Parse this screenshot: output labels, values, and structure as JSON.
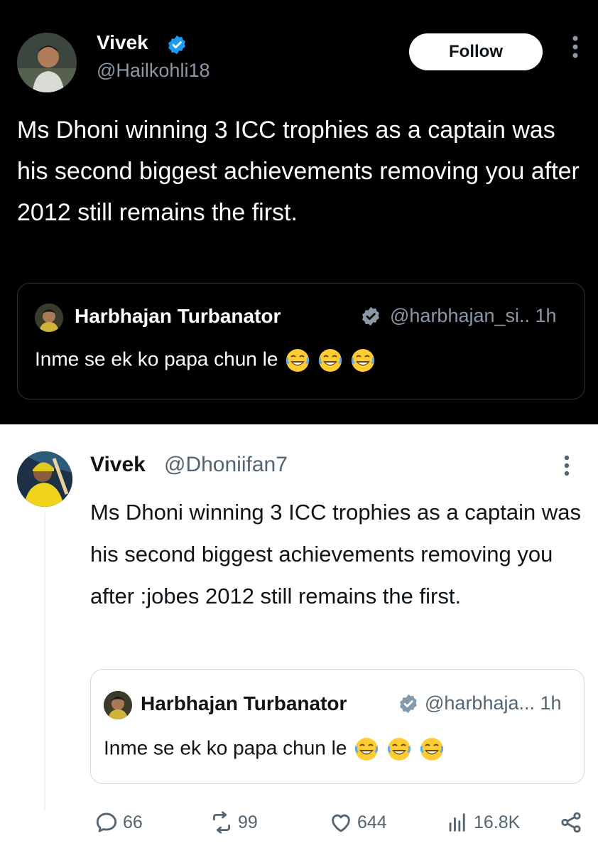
{
  "colors": {
    "dark_bg": "#000000",
    "verified_blue": "#1d9bf0",
    "muted_dark": "#8b98a5",
    "muted_light": "#536471",
    "text_light": "#0f1419"
  },
  "top_post": {
    "author_name": "Vivek",
    "author_handle": "@Hailkohli18",
    "follow_label": "Follow",
    "body": "Ms Dhoni winning 3 ICC trophies as a captain was his second biggest achievements removing you after 2012 still remains the first.",
    "quote": {
      "author_name": "Harbhajan Turbanator",
      "handle_time": "@harbhajan_si.. 1h",
      "text": "Inme se ek ko papa chun le"
    }
  },
  "bottom_post": {
    "author_name": "Vivek",
    "author_handle": "@Dhoniifan7",
    "body": "Ms Dhoni winning 3 ICC trophies as a captain was his second biggest achievements removing you after :jobes 2012 still remains the first.",
    "quote": {
      "author_name": "Harbhajan Turbanator",
      "handle_time": "@harbhaja... 1h",
      "text": "Inme se ek ko papa chun le"
    },
    "actions": {
      "replies": "66",
      "reposts": "99",
      "likes": "644",
      "views": "16.8K"
    }
  },
  "icons": [
    "verified-badge-icon",
    "more-icon",
    "laughing-emoji-icon",
    "reply-icon",
    "repost-icon",
    "like-icon",
    "views-icon",
    "share-icon"
  ]
}
